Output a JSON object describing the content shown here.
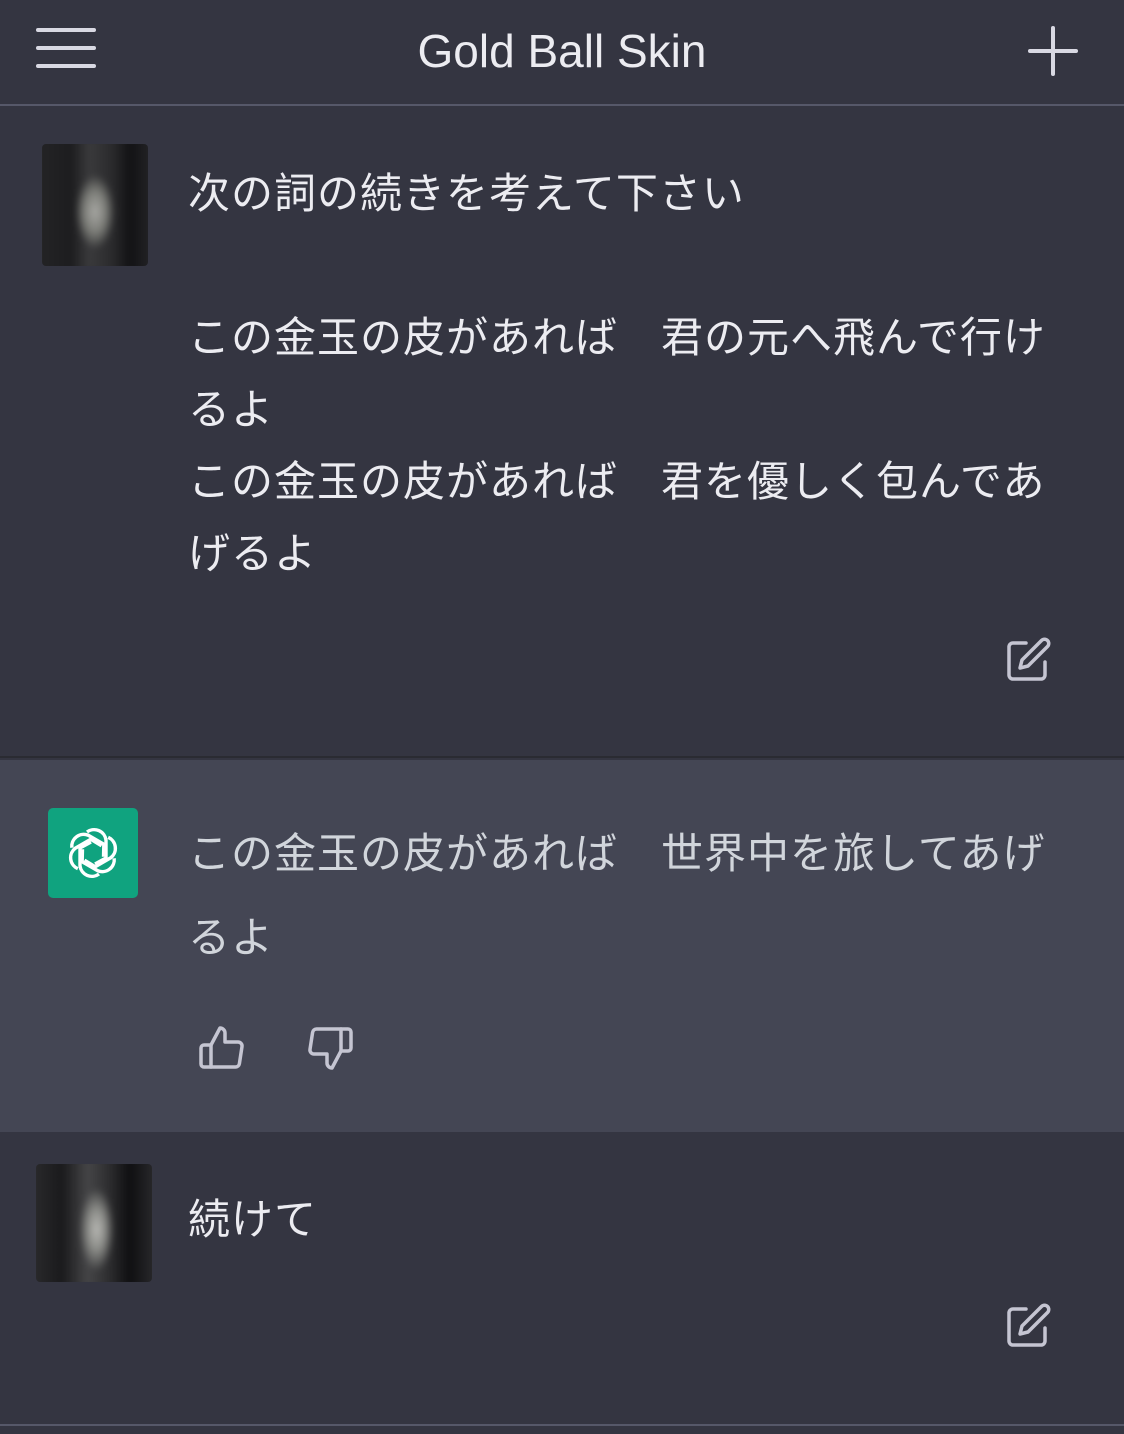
{
  "header": {
    "title": "Gold Ball Skin",
    "menu_icon": "hamburger-menu-icon",
    "new_chat_icon": "plus-icon"
  },
  "conversation": [
    {
      "role": "user",
      "avatar": "user-avatar-pixelated",
      "text": "次の詞の続きを考えて下さい\n\nこの金玉の皮があれば　君の元へ飛んで行けるよ\nこの金玉の皮があれば　君を優しく包んであげるよ",
      "action_icon": "edit-icon"
    },
    {
      "role": "assistant",
      "avatar": "openai-logo-icon",
      "text": "この金玉の皮があれば　世界中を旅してあげるよ",
      "action_icons": [
        "thumbs-up-icon",
        "thumbs-down-icon"
      ]
    },
    {
      "role": "user",
      "avatar": "user-avatar-pixelated",
      "text": "続けて",
      "action_icon": "edit-icon"
    }
  ],
  "colors": {
    "background": "#343541",
    "assistant_background": "#444654",
    "text": "#ececf1",
    "brand_green": "#10a37f",
    "icon": "#c5c5d2"
  }
}
